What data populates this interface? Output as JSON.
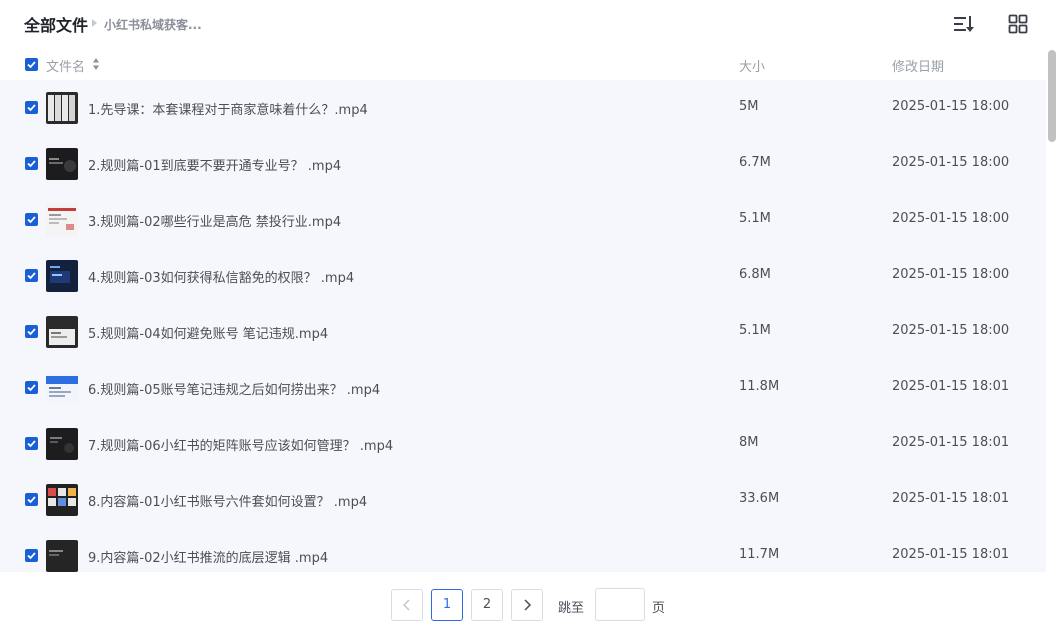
{
  "header": {
    "title": "全部文件",
    "breadcrumb": "小红书私域获客..."
  },
  "columns": {
    "name": "文件名",
    "size": "大小",
    "date": "修改日期"
  },
  "files": [
    {
      "name": "1.先导课：本套课程对于商家意味着什么？.mp4",
      "size": "5M",
      "date": "2025-01-15 18:00",
      "checked": true
    },
    {
      "name": "2.规则篇-01到底要不要开通专业号？ .mp4",
      "size": "6.7M",
      "date": "2025-01-15 18:00",
      "checked": true
    },
    {
      "name": "3.规则篇-02哪些行业是高危 禁投行业.mp4",
      "size": "5.1M",
      "date": "2025-01-15 18:00",
      "checked": true
    },
    {
      "name": "4.规则篇-03如何获得私信豁免的权限？ .mp4",
      "size": "6.8M",
      "date": "2025-01-15 18:00",
      "checked": true
    },
    {
      "name": "5.规则篇-04如何避免账号 笔记违规.mp4",
      "size": "5.1M",
      "date": "2025-01-15 18:00",
      "checked": true
    },
    {
      "name": "6.规则篇-05账号笔记违规之后如何捞出来？ .mp4",
      "size": "11.8M",
      "date": "2025-01-15 18:01",
      "checked": true
    },
    {
      "name": "7.规则篇-06小红书的矩阵账号应该如何管理？ .mp4",
      "size": "8M",
      "date": "2025-01-15 18:01",
      "checked": true
    },
    {
      "name": "8.内容篇-01小红书账号六件套如何设置？ .mp4",
      "size": "33.6M",
      "date": "2025-01-15 18:01",
      "checked": true
    },
    {
      "name": "9.内容篇-02小红书推流的底层逻辑 .mp4",
      "size": "11.7M",
      "date": "2025-01-15 18:01",
      "checked": true
    }
  ],
  "pagination": {
    "pages": [
      "1",
      "2"
    ],
    "current": "1",
    "jump_label": "跳至",
    "page_suffix": "页",
    "jump_value": ""
  },
  "colors": {
    "accent": "#2e6ce6",
    "checkbox": "#1a5fd6",
    "row_bg": "#f6f7fc"
  },
  "icons": {
    "sort_order": "sort-list-icon",
    "view_mode": "grid-view-icon",
    "prev": "chevron-left-icon",
    "next": "chevron-right-icon"
  }
}
